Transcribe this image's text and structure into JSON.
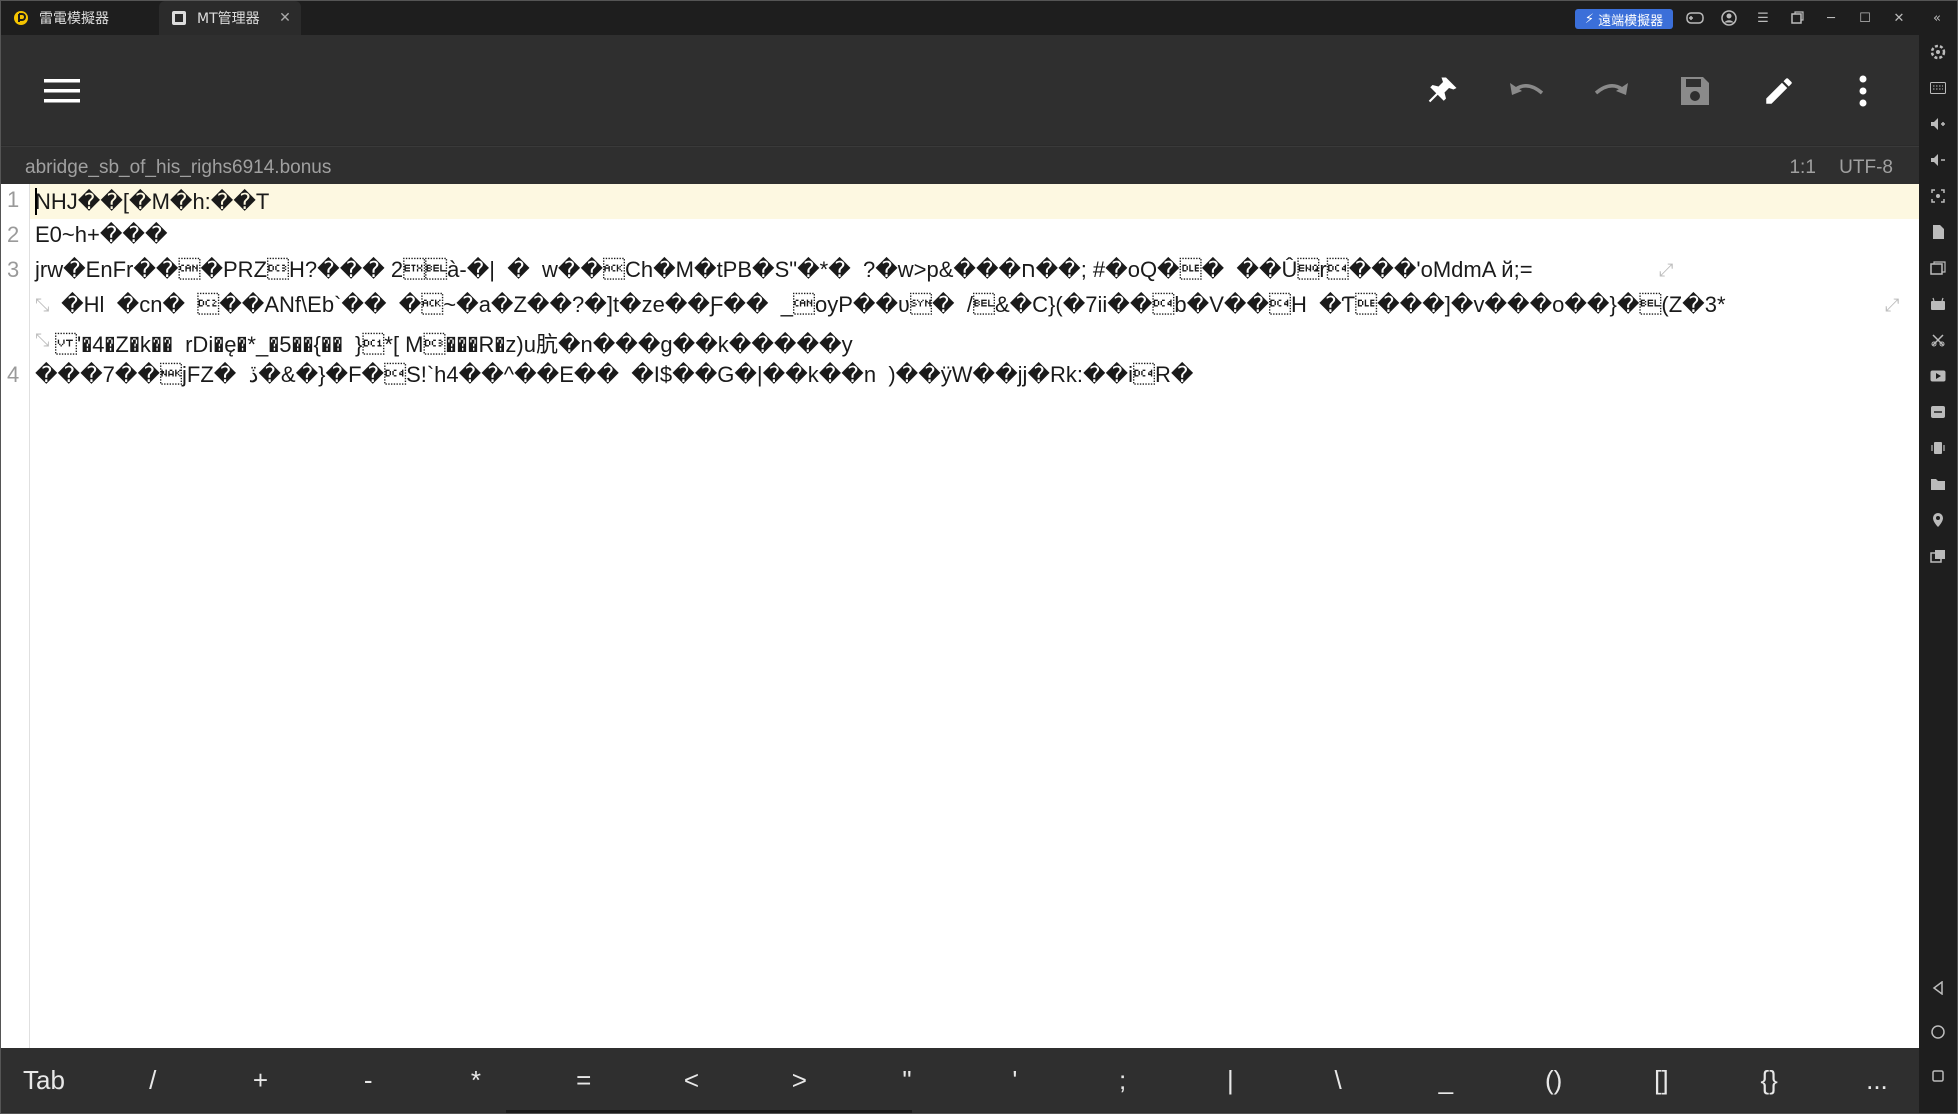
{
  "window": {
    "tabs": [
      {
        "label": "雷電模擬器"
      },
      {
        "label": "MT管理器"
      }
    ],
    "badge_label": "遠端模擬器"
  },
  "toolbar": {
    "icons": [
      "menu-icon",
      "pin-icon",
      "undo-icon",
      "redo-icon",
      "save-icon",
      "edit-icon",
      "more-icon"
    ]
  },
  "file": {
    "name": "abridge_sb_of_his_righs6914.bonus",
    "position": "1:1",
    "encoding": "UTF-8"
  },
  "editor": {
    "lines": [
      {
        "num": "1",
        "text": "NHJ��[�M�h:��T"
      },
      {
        "num": "2",
        "text": "E0~h+���"
      },
      {
        "num": "3",
        "text": "jrw�EnFr��\u0018�PRZ\u0013H?��� 2\u0003\u0007à-�|  �  w��\u0006Ch�M�tPB�S\"�*�  ?�w>p&���ח��; #�oQ�\u0010�  ��Û\u0005r\u0014���'oMdmA й;="
      },
      {
        "num": "",
        "text": " �Hl  �cn�  \u0012��ANf\\Eb`��  �\u0006~�a�Z��?�]t�ze��Ƒ��  _\u0018oyP��ʋ\u0016�  /\u0007&�C}(�7ii��\u0014b�V��\u0014H  �Ƭ\u0010���]�v���o��}�\u0007(Z�3*"
      },
      {
        "num": "",
        "text": "\u000b'�4�Z�k��  rDi�ę�*_�5��{��  }\u0011*[ M\u0013���R�z)u肮�n���g��k�����y"
      },
      {
        "num": "4",
        "text": "���7��\u0015jFZ�  ڏ�&�}�F�\u0014S!`h4��^��E��  �I$��G�|��k��n  )��ÿW��jj�Rk:��i\u0014R�"
      }
    ]
  },
  "symbols": [
    "Tab",
    "/",
    "+",
    "-",
    "*",
    "=",
    "<",
    ">",
    "\"",
    "'",
    ";",
    "|",
    "\\",
    "_",
    "()",
    "[]",
    "{}",
    "..."
  ]
}
